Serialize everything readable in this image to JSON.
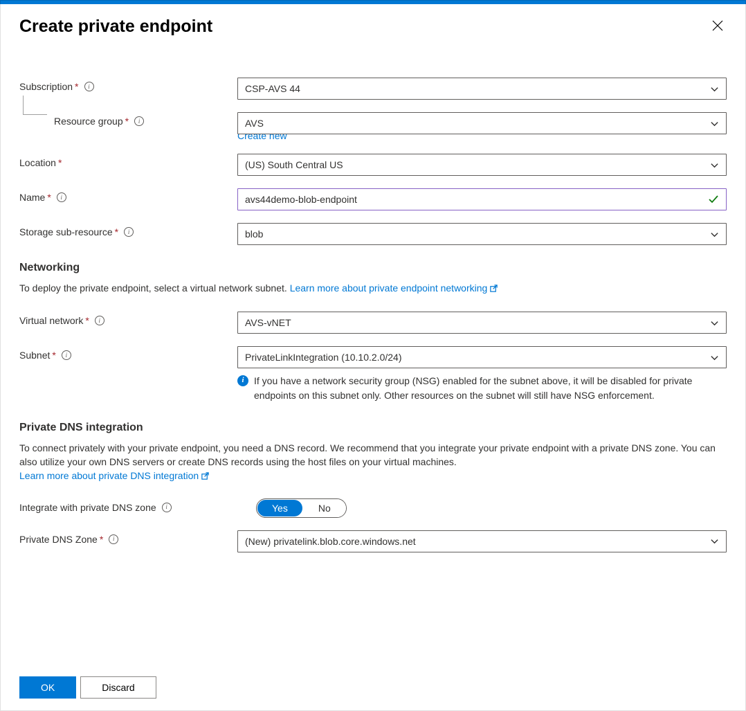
{
  "title": "Create private endpoint",
  "fields": {
    "subscription": {
      "label": "Subscription",
      "value": "CSP-AVS 44"
    },
    "resource_group": {
      "label": "Resource group",
      "value": "AVS",
      "create_new": "Create new"
    },
    "location": {
      "label": "Location",
      "value": "(US) South Central US"
    },
    "name": {
      "label": "Name",
      "value": "avs44demo-blob-endpoint"
    },
    "sub_resource": {
      "label": "Storage sub-resource",
      "value": "blob"
    },
    "virtual_network": {
      "label": "Virtual network",
      "value": "AVS-vNET"
    },
    "subnet": {
      "label": "Subnet",
      "value": "PrivateLinkIntegration (10.10.2.0/24)",
      "note": "If you have a network security group (NSG) enabled for the subnet above, it will be disabled for private endpoints on this subnet only. Other resources on the subnet will still have NSG enforcement."
    },
    "dns_integrate": {
      "label": "Integrate with private DNS zone",
      "yes": "Yes",
      "no": "No"
    },
    "dns_zone": {
      "label": "Private DNS Zone",
      "value": "(New) privatelink.blob.core.windows.net"
    }
  },
  "sections": {
    "networking": {
      "title": "Networking",
      "desc": "To deploy the private endpoint, select a virtual network subnet. ",
      "link": "Learn more about private endpoint networking"
    },
    "dns": {
      "title": "Private DNS integration",
      "desc": "To connect privately with your private endpoint, you need a DNS record. We recommend that you integrate your private endpoint with a private DNS zone. You can also utilize your own DNS servers or create DNS records using the host files on your virtual machines.",
      "link": "Learn more about private DNS integration"
    }
  },
  "buttons": {
    "ok": "OK",
    "discard": "Discard"
  }
}
